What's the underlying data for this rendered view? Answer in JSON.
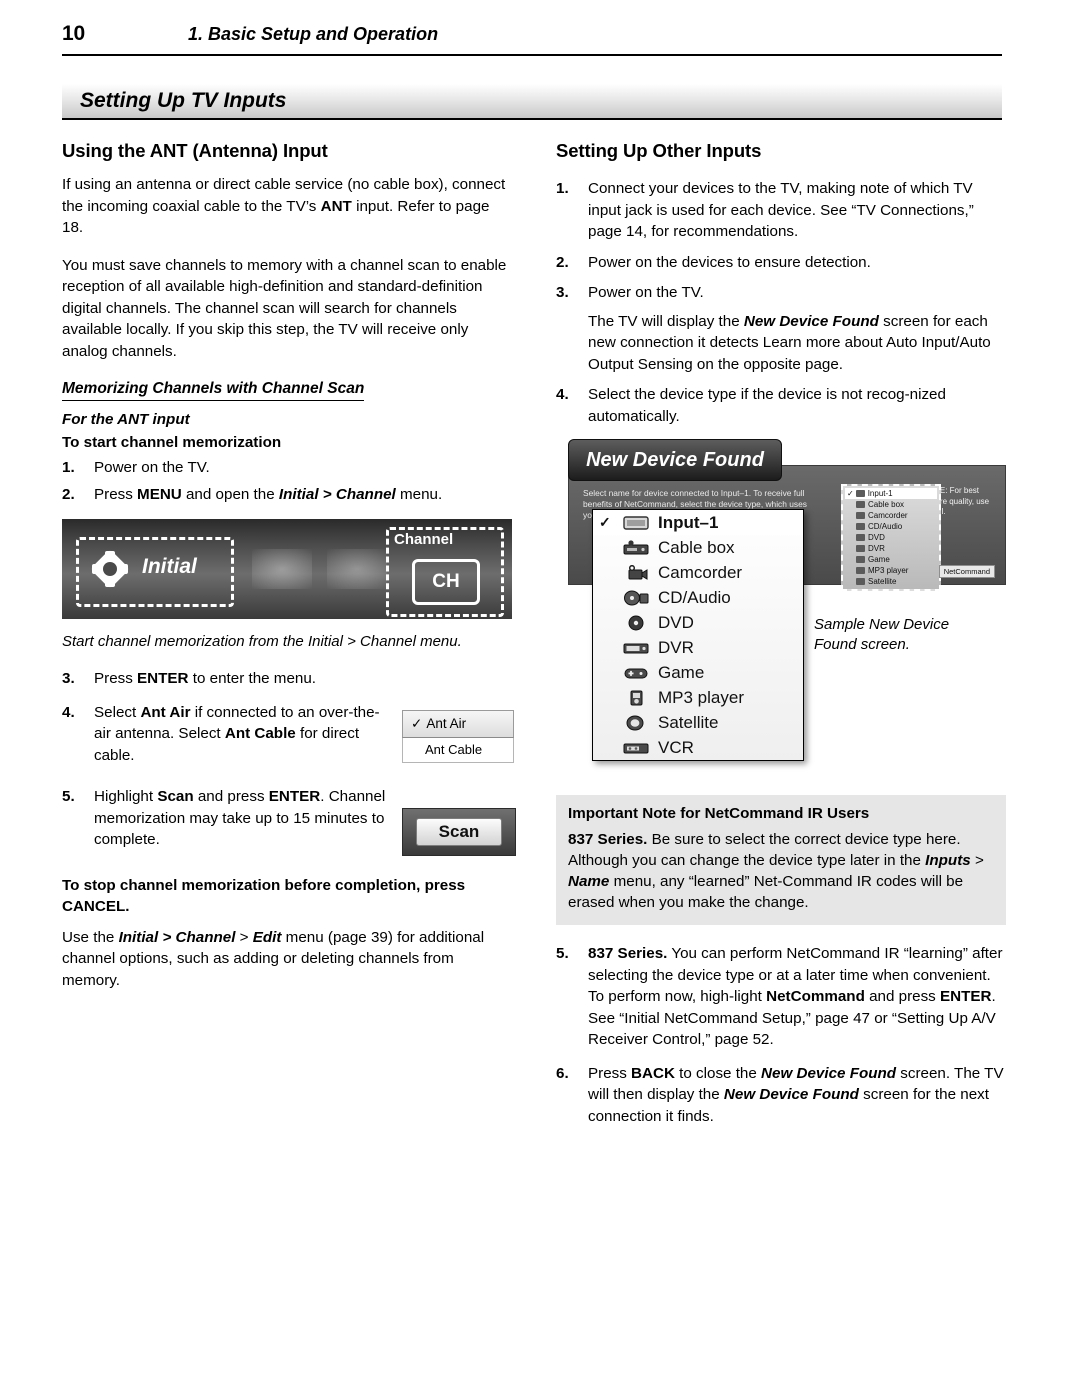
{
  "header": {
    "page_number": "10",
    "chapter_title": "1.  Basic Setup and Operation",
    "section_title": "Setting Up TV Inputs"
  },
  "left": {
    "heading": "Using the ANT (Antenna) Input",
    "para1_a": "If using an antenna or direct cable service (no cable box), connect the incoming coaxial cable to the TV’s ",
    "para1_b": "ANT",
    "para1_c": " input.  Refer to page 18.",
    "para2": "You must save channels to memory with a channel scan to enable reception of all available high-definition and standard-definition digital channels.  The channel  scan will search for channels available locally.  If you skip this step, the TV will receive only analog channels.",
    "memorizing_heading": "Memorizing Channels with Channel Scan",
    "for_ant_heading": "For the ANT input",
    "to_start_heading": "To start channel memorization",
    "steps": [
      {
        "num": "1.",
        "text": "Power on the TV."
      },
      {
        "num": "2.",
        "text": "Press MENU and open the Initial > Channel menu."
      }
    ],
    "menu_shot": {
      "initial_label": "Initial",
      "channel_label": "Channel",
      "ch_label": "CH"
    },
    "shot_caption": "Start channel memorization from the Initial > Channel menu.",
    "steps2": [
      {
        "num": "3.",
        "text": "Press ENTER to enter the menu."
      },
      {
        "num": "4.",
        "text": "Select Ant Air if connected to an over-the-air antenna.  Select Ant Cable for direct cable."
      },
      {
        "num": "5.",
        "text": "Highlight Scan and press ENTER.  Channel memorization may take up to 15 minutes to complete."
      }
    ],
    "ant_air_button": "Ant Air",
    "ant_air_check": "✓",
    "ant_cable_button": "Ant Cable",
    "scan_button": "Scan",
    "stop_heading": "To stop channel memorization before completion, press CANCEL.",
    "para3": "Use the Initial > Channel > Edit menu (page 39) for additional channel options, such as adding or deleting channels from memory."
  },
  "right": {
    "heading": "Setting Up Other Inputs",
    "steps": [
      {
        "num": "1.",
        "text": "Connect your devices to the TV, making note of which TV input jack is used for each device.  See “TV Connections,” page 14, for recommendations."
      },
      {
        "num": "2.",
        "text": "Power on the devices to ensure detection."
      },
      {
        "num": "3.",
        "text": "Power on the TV.",
        "sub": "The TV will display the New Device Found screen for each new connection it detects  Learn more about Auto Input/Auto Output Sensing on the opposite page."
      },
      {
        "num": "4.",
        "text": "Select the device type if the device is not recog-nized automatically."
      }
    ],
    "ndf": {
      "banner": "New Device Found",
      "body_text": "Select name for device connected to Input–1. To receive full benefits of NetCommand, select the device type, which uses your Mitsubishi remote to control other devices.",
      "note_text": "NOTE: For best picture quality, use HDMI.",
      "netcommand_badge": "NetCommand",
      "mini_list": [
        "Input-1",
        "Cable box",
        "Camcorder",
        "CD/Audio",
        "DVD",
        "DVR",
        "Game",
        "MP3 player",
        "Satellite"
      ],
      "device_list": [
        {
          "label": "Input–1",
          "icon": "input-icon",
          "checked": true
        },
        {
          "label": "Cable box",
          "icon": "cable-box-icon",
          "checked": false
        },
        {
          "label": "Camcorder",
          "icon": "camcorder-icon",
          "checked": false
        },
        {
          "label": "CD/Audio",
          "icon": "cd-audio-icon",
          "checked": false
        },
        {
          "label": "DVD",
          "icon": "dvd-icon",
          "checked": false
        },
        {
          "label": "DVR",
          "icon": "dvr-icon",
          "checked": false
        },
        {
          "label": "Game",
          "icon": "game-icon",
          "checked": false
        },
        {
          "label": "MP3 player",
          "icon": "mp3-player-icon",
          "checked": false
        },
        {
          "label": "Satellite",
          "icon": "satellite-icon",
          "checked": false
        },
        {
          "label": "VCR",
          "icon": "vcr-icon",
          "checked": false
        }
      ],
      "caption": "Sample New Device Found screen."
    },
    "notebox": {
      "heading": "Important Note for NetCommand IR Users",
      "text_a": "837 Series.",
      "text_b": "  Be sure to select the correct device type here.  Although you can change the device type later in the ",
      "text_c": "Inputs",
      "text_d": " > ",
      "text_e": "Name",
      "text_f": " menu, any “learned” Net-Command IR codes will be erased when you make the change."
    },
    "steps2": [
      {
        "num": "5.",
        "text": "837 Series.  You can perform NetCommand IR “learning” after selecting the device type or at a later time when convenient.  To perform now, high-light NetCommand and press ENTER.  See “Initial NetCommand Setup,” page 47 or “Setting Up A/V Receiver Control,” page 52."
      },
      {
        "num": "6.",
        "text": "Press BACK to close the New Device Found screen.  The TV will then display the New Device Found screen for the next connection it finds."
      }
    ]
  }
}
